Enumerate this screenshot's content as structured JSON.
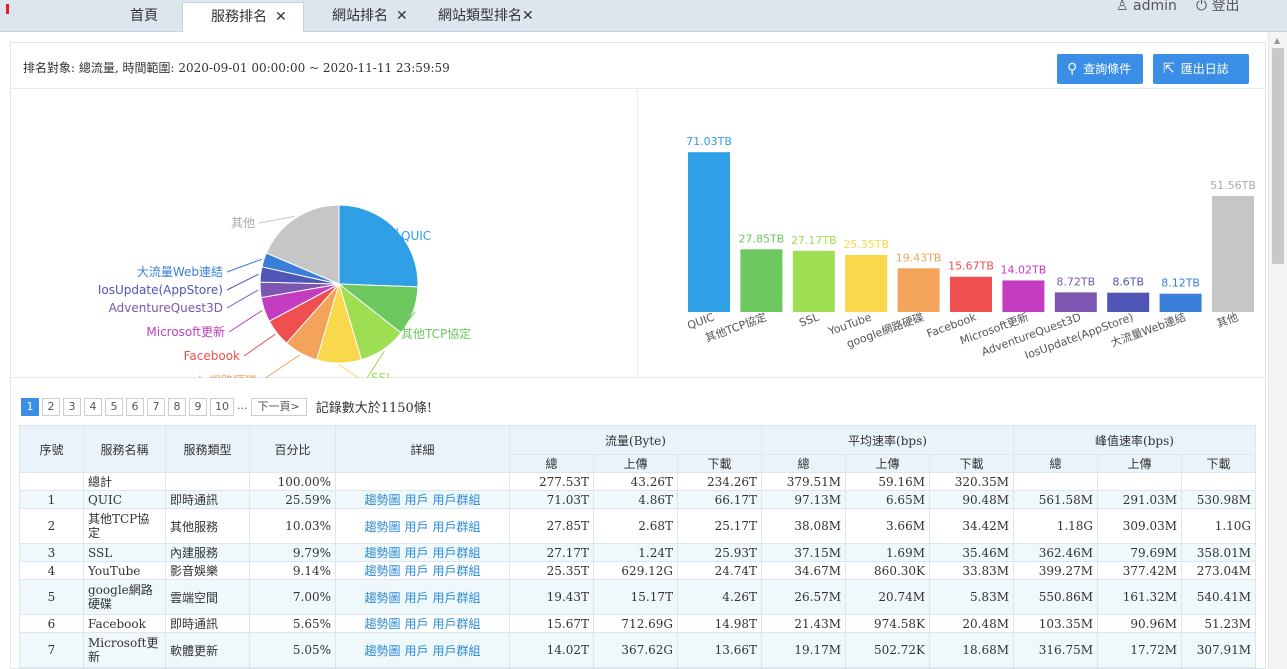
{
  "tabs": [
    {
      "label": "首頁",
      "closable": false,
      "active": false
    },
    {
      "label": "服務排名",
      "closable": true,
      "active": true
    },
    {
      "label": "網站排名",
      "closable": true,
      "active": false
    },
    {
      "label": "網站類型排名",
      "closable": true,
      "active": false
    }
  ],
  "user": {
    "name": "admin",
    "logout": "登出"
  },
  "info": {
    "text": "排名對象: 總流量, 時間範圍: 2020-09-01 00:00:00 ~ 2020-11-11 23:59:59"
  },
  "buttons": {
    "query": "查詢條件",
    "export": "匯出日誌"
  },
  "chart_data": [
    {
      "type": "pie",
      "labels": [
        "QUIC",
        "其他TCP協定",
        "SSL",
        "YouTube",
        "google網路硬碟",
        "Facebook",
        "Microsoft更新",
        "AdventureQuest3D",
        "IosUpdate(AppStore)",
        "大流量Web連結",
        "其他"
      ],
      "values": [
        25.59,
        10.03,
        9.79,
        9.14,
        7.0,
        5.65,
        5.05,
        3.14,
        3.1,
        2.93,
        18.58
      ],
      "colors": [
        "#2f9fe6",
        "#6cc85f",
        "#9ede53",
        "#fad84c",
        "#f3a35a",
        "#ee4f4f",
        "#c43dc0",
        "#7b57b1",
        "#4f56b5",
        "#3a7ed8",
        "#c6c6c6"
      ]
    },
    {
      "type": "bar",
      "categories": [
        "QUIC",
        "其他TCP協定",
        "SSL",
        "YouTube",
        "google網路硬碟",
        "Facebook",
        "Microsoft更新",
        "AdventureQuest3D",
        "IosUpdate(AppStore)",
        "大流量Web連結",
        "其他"
      ],
      "values": [
        71.03,
        27.85,
        27.17,
        25.35,
        19.43,
        15.67,
        14.02,
        8.72,
        8.6,
        8.12,
        51.56
      ],
      "value_labels": [
        "71.03TB",
        "27.85TB",
        "27.17TB",
        "25.35TB",
        "19.43TB",
        "15.67TB",
        "14.02TB",
        "8.72TB",
        "8.6TB",
        "8.12TB",
        "51.56TB"
      ],
      "ylim": [
        0,
        80
      ],
      "colors": [
        "#2f9fe6",
        "#6cc85f",
        "#9ede53",
        "#fad84c",
        "#f3a35a",
        "#ee4f4f",
        "#c43dc0",
        "#7b57b1",
        "#4f56b5",
        "#3a7ed8",
        "#c6c6c6"
      ]
    }
  ],
  "pager": {
    "pages": [
      "1",
      "2",
      "3",
      "4",
      "5",
      "6",
      "7",
      "8",
      "9",
      "10"
    ],
    "current": "1",
    "ellipsis": "...",
    "next": "下一頁>",
    "count_text": "記錄數大於1150條!"
  },
  "table": {
    "headers": {
      "index": "序號",
      "name": "服務名稱",
      "type": "服務類型",
      "percent": "百分比",
      "detail": "詳細",
      "traffic": "流量(Byte)",
      "avg_rate": "平均速率(bps)",
      "peak_rate": "峰值速率(bps)",
      "total": "總",
      "up": "上傳",
      "down": "下載"
    },
    "links": [
      "趨勢圖",
      "用戶",
      "用戶群組"
    ],
    "total_row": {
      "label": "總計",
      "percent": "100.00%",
      "t_total": "277.53T",
      "t_up": "43.26T",
      "t_down": "234.26T",
      "a_total": "379.51M",
      "a_up": "59.16M",
      "a_down": "320.35M"
    },
    "rows": [
      {
        "idx": "1",
        "name": "QUIC",
        "type": "即時通訊",
        "percent": "25.59%",
        "t_total": "71.03T",
        "t_up": "4.86T",
        "t_down": "66.17T",
        "a_total": "97.13M",
        "a_up": "6.65M",
        "a_down": "90.48M",
        "p_total": "561.58M",
        "p_up": "291.03M",
        "p_down": "530.98M"
      },
      {
        "idx": "2",
        "name": "其他TCP協定",
        "type": "其他服務",
        "percent": "10.03%",
        "t_total": "27.85T",
        "t_up": "2.68T",
        "t_down": "25.17T",
        "a_total": "38.08M",
        "a_up": "3.66M",
        "a_down": "34.42M",
        "p_total": "1.18G",
        "p_up": "309.03M",
        "p_down": "1.10G"
      },
      {
        "idx": "3",
        "name": "SSL",
        "type": "內建服務",
        "percent": "9.79%",
        "t_total": "27.17T",
        "t_up": "1.24T",
        "t_down": "25.93T",
        "a_total": "37.15M",
        "a_up": "1.69M",
        "a_down": "35.46M",
        "p_total": "362.46M",
        "p_up": "79.69M",
        "p_down": "358.01M"
      },
      {
        "idx": "4",
        "name": "YouTube",
        "type": "影音娛樂",
        "percent": "9.14%",
        "t_total": "25.35T",
        "t_up": "629.12G",
        "t_down": "24.74T",
        "a_total": "34.67M",
        "a_up": "860.30K",
        "a_down": "33.83M",
        "p_total": "399.27M",
        "p_up": "377.42M",
        "p_down": "273.04M"
      },
      {
        "idx": "5",
        "name": "google網路硬碟",
        "type": "雲端空間",
        "percent": "7.00%",
        "t_total": "19.43T",
        "t_up": "15.17T",
        "t_down": "4.26T",
        "a_total": "26.57M",
        "a_up": "20.74M",
        "a_down": "5.83M",
        "p_total": "550.86M",
        "p_up": "161.32M",
        "p_down": "540.41M"
      },
      {
        "idx": "6",
        "name": "Facebook",
        "type": "即時通訊",
        "percent": "5.65%",
        "t_total": "15.67T",
        "t_up": "712.69G",
        "t_down": "14.98T",
        "a_total": "21.43M",
        "a_up": "974.58K",
        "a_down": "20.48M",
        "p_total": "103.35M",
        "p_up": "90.96M",
        "p_down": "51.23M"
      },
      {
        "idx": "7",
        "name": "Microsoft更新",
        "type": "軟體更新",
        "percent": "5.05%",
        "t_total": "14.02T",
        "t_up": "367.62G",
        "t_down": "13.66T",
        "a_total": "19.17M",
        "a_up": "502.72K",
        "a_down": "18.68M",
        "p_total": "316.75M",
        "p_up": "17.72M",
        "p_down": "307.91M"
      }
    ]
  }
}
